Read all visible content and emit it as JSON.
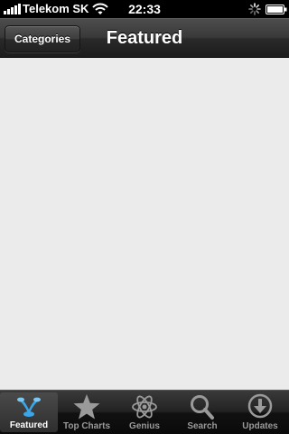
{
  "status_bar": {
    "carrier": "Telekom SK",
    "time": "22:33",
    "signal_icon": "signal-bars-icon",
    "wifi_icon": "wifi-icon",
    "activity_icon": "activity-spinner-icon",
    "battery_icon": "battery-icon"
  },
  "nav_bar": {
    "left_button_label": "Categories",
    "title": "Featured"
  },
  "content": {
    "background": "#ebebeb"
  },
  "tab_bar": {
    "active_color": "#3aa6e8",
    "tabs": [
      {
        "label": "Featured",
        "icon": "featured-icon",
        "active": true
      },
      {
        "label": "Top Charts",
        "icon": "star-icon",
        "active": false
      },
      {
        "label": "Genius",
        "icon": "genius-atom-icon",
        "active": false
      },
      {
        "label": "Search",
        "icon": "search-icon",
        "active": false
      },
      {
        "label": "Updates",
        "icon": "updates-download-icon",
        "active": false
      }
    ]
  }
}
